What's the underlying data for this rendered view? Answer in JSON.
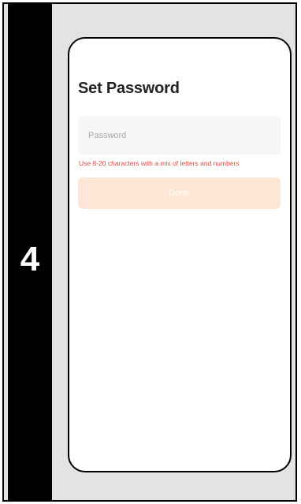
{
  "step": {
    "number": "4"
  },
  "screen": {
    "title": "Set Password",
    "password_field": {
      "placeholder": "Password",
      "value": ""
    },
    "hint": "Use 8-20 characters with a mix of letters and numbers",
    "done_button": {
      "label": "Done",
      "state": "disabled"
    }
  },
  "colors": {
    "step_strip": "#000000",
    "backdrop": "#e3e3e3",
    "hint_text": "#e0443b",
    "done_button_bg": "#fde6d6"
  }
}
